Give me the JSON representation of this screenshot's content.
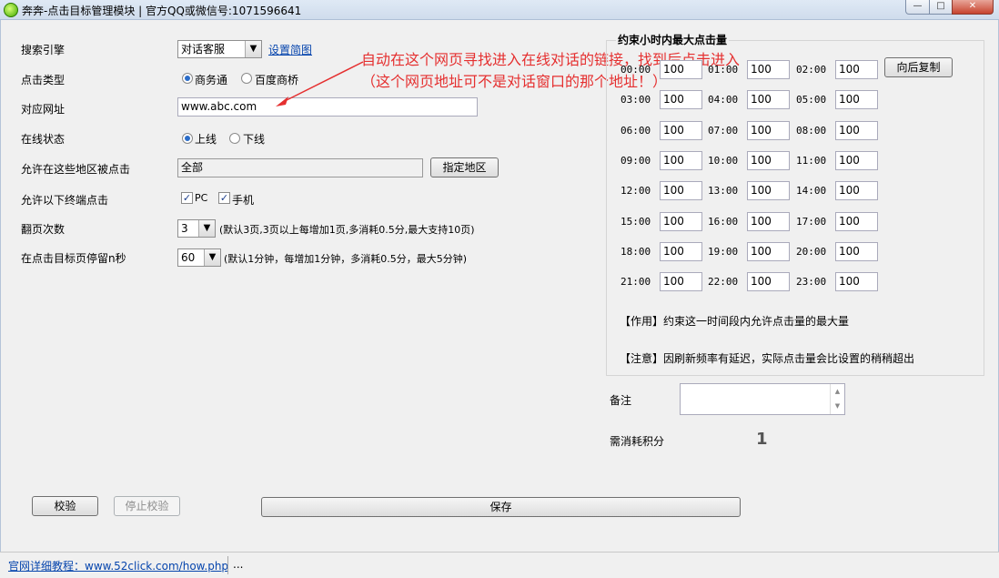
{
  "window": {
    "title": "奔奔-点击目标管理模块 | 官方QQ或微信号:1071596641",
    "min_glyph": "—",
    "max_glyph": "□",
    "close_glyph": "✕"
  },
  "form": {
    "search_engine": {
      "label": "搜索引擎",
      "value": "对话客服",
      "link": "设置简图"
    },
    "click_type": {
      "label": "点击类型",
      "options": [
        "商务通",
        "百度商桥"
      ],
      "selected": "商务通"
    },
    "url": {
      "label": "对应网址",
      "value": "www.abc.com"
    },
    "online_status": {
      "label": "在线状态",
      "options": [
        "上线",
        "下线"
      ],
      "selected": "上线"
    },
    "regions": {
      "label": "允许在这些地区被点击",
      "value": "全部",
      "button": "指定地区"
    },
    "terminals": {
      "label": "允许以下终端点击",
      "options": [
        "PC",
        "手机"
      ],
      "checked": [
        "PC",
        "手机"
      ]
    },
    "pages": {
      "label": "翻页次数",
      "value": "3",
      "hint": "(默认3页,3页以上每增加1页,多消耗0.5分,最大支持10页)"
    },
    "stay": {
      "label": "在点击目标页停留n秒",
      "value": "60",
      "hint": "(默认1分钟，每增加1分钟，多消耗0.5分，最大5分钟)"
    }
  },
  "annotation": {
    "line1": "自动在这个网页寻找进入在线对话的链接，找到后点击进入",
    "line2": "（这个网页地址可不是对话窗口的那个地址！）",
    "color": "#e53030"
  },
  "hourly": {
    "title": "约束小时内最大点击量",
    "copy_button": "向后复制",
    "slots": [
      {
        "time": "00:00",
        "value": "100"
      },
      {
        "time": "01:00",
        "value": "100"
      },
      {
        "time": "02:00",
        "value": "100"
      },
      {
        "time": "03:00",
        "value": "100"
      },
      {
        "time": "04:00",
        "value": "100"
      },
      {
        "time": "05:00",
        "value": "100"
      },
      {
        "time": "06:00",
        "value": "100"
      },
      {
        "time": "07:00",
        "value": "100"
      },
      {
        "time": "08:00",
        "value": "100"
      },
      {
        "time": "09:00",
        "value": "100"
      },
      {
        "time": "10:00",
        "value": "100"
      },
      {
        "time": "11:00",
        "value": "100"
      },
      {
        "time": "12:00",
        "value": "100"
      },
      {
        "time": "13:00",
        "value": "100"
      },
      {
        "time": "14:00",
        "value": "100"
      },
      {
        "time": "15:00",
        "value": "100"
      },
      {
        "time": "16:00",
        "value": "100"
      },
      {
        "time": "17:00",
        "value": "100"
      },
      {
        "time": "18:00",
        "value": "100"
      },
      {
        "time": "19:00",
        "value": "100"
      },
      {
        "time": "20:00",
        "value": "100"
      },
      {
        "time": "21:00",
        "value": "100"
      },
      {
        "time": "22:00",
        "value": "100"
      },
      {
        "time": "23:00",
        "value": "100"
      }
    ],
    "note_purpose": "【作用】约束这一时间段内允许点击量的最大量",
    "note_caution": "【注意】因刷新频率有延迟，实际点击量会比设置的稍稍超出"
  },
  "remark": {
    "label": "备注",
    "value": ""
  },
  "cost": {
    "label": "需消耗积分",
    "value": "1"
  },
  "buttons": {
    "verify": "校验",
    "stop_verify": "停止校验",
    "save": "保存"
  },
  "status": {
    "link": "官网详细教程：www.52click.com/how.php",
    "extra": "..."
  }
}
